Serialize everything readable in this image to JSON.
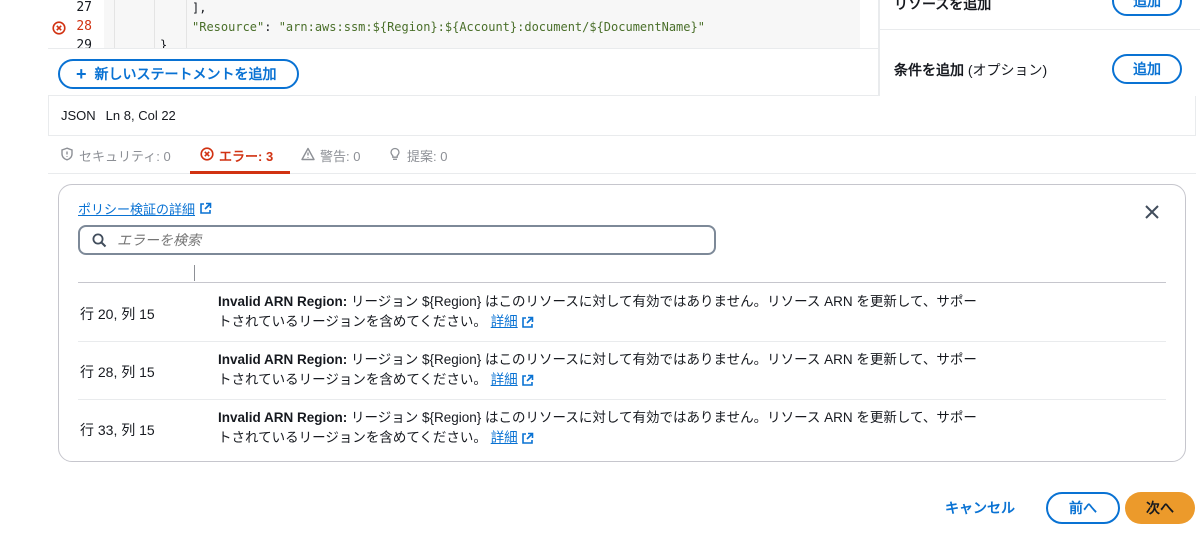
{
  "editor": {
    "lines": [
      {
        "num": "27",
        "code": "],"
      },
      {
        "num": "28",
        "code_key": "\"Resource\"",
        "code_sep": ": ",
        "code_value": "\"arn:aws:ssm:${Region}:${Account}:document/${DocumentName}\""
      },
      {
        "num": "29",
        "code": "}"
      }
    ],
    "add_statement_label": "新しいステートメントを追加"
  },
  "right_panel": {
    "resource_label": "リソースを追加",
    "resource_button": "追加",
    "condition_label": "条件を追加",
    "condition_optional": " (オプション)",
    "condition_button": "追加"
  },
  "status": {
    "mode": "JSON",
    "position": "Ln 8, Col 22"
  },
  "tabs": [
    {
      "label": "セキュリティ: 0"
    },
    {
      "label": "エラー: 3"
    },
    {
      "label": "警告: 0"
    },
    {
      "label": "提案: 0"
    }
  ],
  "errors_panel": {
    "link_label": "ポリシー検証の詳細",
    "search_placeholder": "エラーを検索",
    "rows": [
      {
        "location": "行 20, 列 15",
        "title": "Invalid ARN Region:",
        "message": " リージョン ${Region} はこのリソースに対して有効ではありません。リソース ARN を更新して、サポートされているリージョンを含めてください。",
        "link": "詳細"
      },
      {
        "location": "行 28, 列 15",
        "title": "Invalid ARN Region:",
        "message": " リージョン ${Region} はこのリソースに対して有効ではありません。リソース ARN を更新して、サポートされているリージョンを含めてください。",
        "link": "詳細"
      },
      {
        "location": "行 33, 列 15",
        "title": "Invalid ARN Region:",
        "message": " リージョン ${Region} はこのリソースに対して有効ではありません。リソース ARN を更新して、サポートされているリージョンを含めてください。",
        "link": "詳細"
      }
    ]
  },
  "footer": {
    "cancel_label": "キャンセル",
    "prev_label": "前へ",
    "next_label": "次へ"
  },
  "colors": {
    "accent": "#0972d3",
    "error": "#d13212",
    "primary_button": "#ec9a2b"
  }
}
